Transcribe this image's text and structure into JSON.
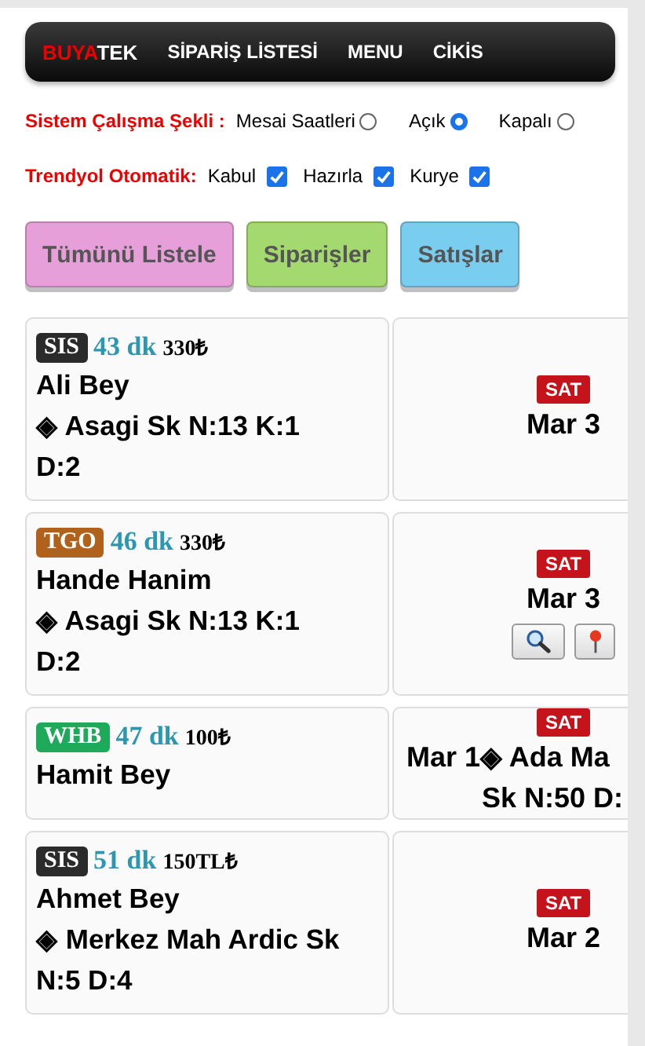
{
  "navbar": {
    "brand_red": "BUYA",
    "brand_white": "TEK",
    "items": [
      "SİPARİŞ LİSTESİ",
      "MENU",
      "CİKİS"
    ]
  },
  "work_mode": {
    "label": "Sistem Çalışma Şekli :",
    "options": [
      {
        "label": "Mesai Saatleri",
        "selected": false
      },
      {
        "label": "Açık",
        "selected": true
      },
      {
        "label": "Kapalı",
        "selected": false
      }
    ]
  },
  "trendyol_auto": {
    "label": "Trendyol Otomatik:",
    "options": [
      {
        "label": "Kabul",
        "checked": true
      },
      {
        "label": "Hazırla",
        "checked": true
      },
      {
        "label": "Kurye",
        "checked": true
      }
    ]
  },
  "buttons": [
    {
      "label": "Tümünü Listele",
      "color": "#e79fd9"
    },
    {
      "label": "Siparişler",
      "color": "#a3d96f"
    },
    {
      "label": "Satışlar",
      "color": "#79cdef"
    }
  ],
  "orders": [
    {
      "source": "SIS",
      "color": "#2b2b2b",
      "minutes": "43 dk",
      "price": "330₺",
      "name": "Ali Bey",
      "address": "◈ Asagi Sk N:13 K:1 D:2",
      "status": "SAT",
      "date": "Mar 3",
      "tools": false
    },
    {
      "source": "TGO",
      "color": "#b0621c",
      "minutes": "46 dk",
      "price": "330₺",
      "name": "Hande Hanim",
      "address": "◈ Asagi Sk N:13 K:1 D:2",
      "status": "SAT",
      "date": "Mar 3",
      "tools": true
    },
    {
      "source": "WHB",
      "color": "#1ea95b",
      "minutes": "47 dk",
      "price": "100₺",
      "name": "Hamit Bey",
      "status": "SAT",
      "date": "Mar 1",
      "side_address": [
        "◈ Ada Ma",
        "Sk N:50 D:"
      ],
      "tools": false
    },
    {
      "source": "SIS",
      "color": "#2b2b2b",
      "minutes": "51 dk",
      "price": "150TL₺",
      "name": "Ahmet Bey",
      "address": "◈ Merkez Mah Ardic Sk N:5 D:4",
      "status": "SAT",
      "date": "Mar 2",
      "tools": false
    }
  ]
}
